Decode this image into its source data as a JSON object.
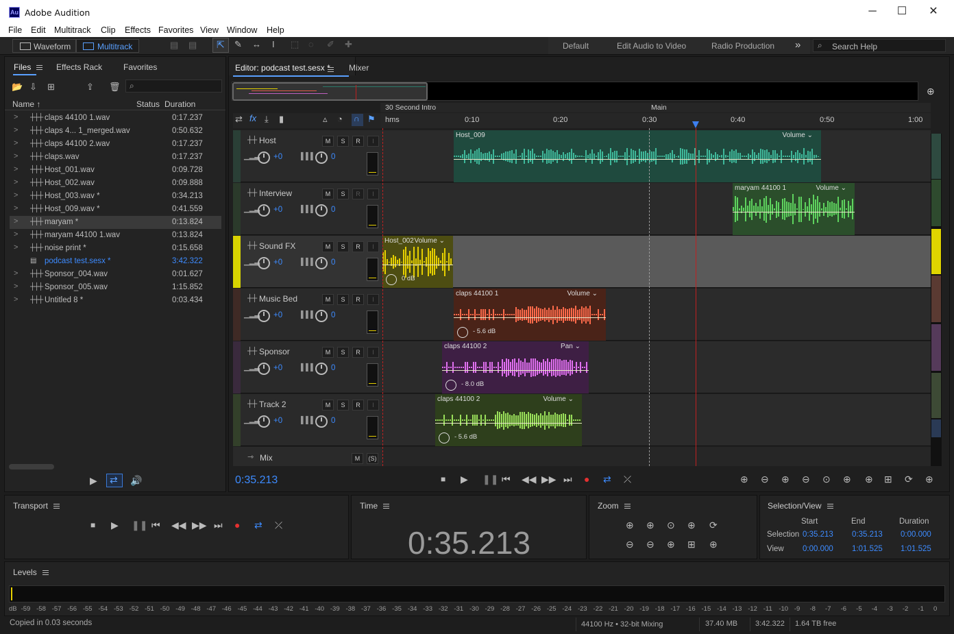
{
  "app": {
    "title": "Adobe Audition",
    "logo": "Au",
    "icons": {
      "minimize": "─",
      "maximize": "☐",
      "close": "✕"
    }
  },
  "menu": [
    "File",
    "Edit",
    "Multitrack",
    "Clip",
    "Effects",
    "Favorites",
    "View",
    "Window",
    "Help"
  ],
  "toolbar": {
    "waveform": "Waveform",
    "multitrack": "Multitrack",
    "workspaces": [
      "Default",
      "Edit Audio to Video",
      "Radio Production"
    ],
    "more": "»",
    "search_placeholder": "Search Help"
  },
  "files_panel": {
    "tabs": [
      "Files",
      "Effects Rack",
      "Favorites"
    ],
    "columns": {
      "name": "Name",
      "status": "Status",
      "duration": "Duration"
    },
    "items": [
      {
        "name": "claps 44100 1.wav",
        "duration": "0:17.237",
        "type": "wave"
      },
      {
        "name": "claps 4... 1_merged.wav",
        "duration": "0:50.632",
        "type": "wave"
      },
      {
        "name": "claps 44100 2.wav",
        "duration": "0:17.237",
        "type": "wave"
      },
      {
        "name": "claps.wav",
        "duration": "0:17.237",
        "type": "wave"
      },
      {
        "name": "Host_001.wav",
        "duration": "0:09.728",
        "type": "wave"
      },
      {
        "name": "Host_002.wav",
        "duration": "0:09.888",
        "type": "wave"
      },
      {
        "name": "Host_003.wav *",
        "duration": "0:34.213",
        "type": "wave"
      },
      {
        "name": "Host_009.wav *",
        "duration": "0:41.559",
        "type": "wave"
      },
      {
        "name": "maryam *",
        "duration": "0:13.824",
        "type": "wave",
        "selected": true
      },
      {
        "name": "maryam 44100 1.wav",
        "duration": "0:13.824",
        "type": "wave"
      },
      {
        "name": "noise print *",
        "duration": "0:15.658",
        "type": "wave"
      },
      {
        "name": "podcast test.sesx *",
        "duration": "3:42.322",
        "type": "session"
      },
      {
        "name": "Sponsor_004.wav",
        "duration": "0:01.627",
        "type": "wave"
      },
      {
        "name": "Sponsor_005.wav",
        "duration": "1:15.852",
        "type": "wave"
      },
      {
        "name": "Untitled 8 *",
        "duration": "0:03.434",
        "type": "wave"
      }
    ]
  },
  "editor": {
    "tab": "Editor: podcast test.sesx *",
    "mixer_tab": "Mixer",
    "time": "0:35.213",
    "markers": [
      "30 Second Intro",
      "Main"
    ],
    "ruler": [
      "hms",
      "0:10",
      "0:20",
      "0:30",
      "0:40",
      "0:50",
      "1:00"
    ],
    "tracks": [
      {
        "name": "Host",
        "vol": "+0",
        "pan": "0",
        "color": "#2c5b4c",
        "strip": "#2a3f36"
      },
      {
        "name": "Interview",
        "vol": "+0",
        "pan": "0",
        "color": "#2e5b2e",
        "strip": "#2b3a2b"
      },
      {
        "name": "Sound FX",
        "vol": "+0",
        "pan": "0",
        "color": "#6b6b20",
        "strip": "#d8d400"
      },
      {
        "name": "Music Bed",
        "vol": "+0",
        "pan": "0",
        "color": "#5a2d22",
        "strip": "#3f2a25"
      },
      {
        "name": "Sponsor",
        "vol": "+0",
        "pan": "0",
        "color": "#4f2a55",
        "strip": "#3a2a3d"
      },
      {
        "name": "Track 2",
        "vol": "+0",
        "pan": "0",
        "color": "#3d5225",
        "strip": "#33402a"
      }
    ],
    "mix_label": "Mix",
    "btn": {
      "m": "M",
      "s": "S",
      "r": "R",
      "i": "I"
    },
    "clips": [
      {
        "name": "Host_009",
        "env": "Volume"
      },
      {
        "name": "maryam 44100 1",
        "env": "Volume"
      },
      {
        "name": "Host_002",
        "env": "Volume",
        "db": "0 dB"
      },
      {
        "name": "claps 44100 1",
        "env": "Volume",
        "db": "- 5.6 dB"
      },
      {
        "name": "claps 44100 2",
        "env": "Pan",
        "db": "- 8.0 dB"
      },
      {
        "name": "claps 44100 2",
        "env": "Volume",
        "db": "- 5.6 dB"
      }
    ]
  },
  "transport": {
    "title": "Transport"
  },
  "time_panel": {
    "title": "Time",
    "value": "0:35.213"
  },
  "zoom_panel": {
    "title": "Zoom"
  },
  "selection_view": {
    "title": "Selection/View",
    "headers": [
      "Start",
      "End",
      "Duration"
    ],
    "selection": {
      "label": "Selection",
      "start": "0:35.213",
      "end": "0:35.213",
      "duration": "0:00.000"
    },
    "view": {
      "label": "View",
      "start": "0:00.000",
      "end": "1:01.525",
      "duration": "1:01.525"
    }
  },
  "levels": {
    "title": "Levels",
    "scale": [
      "dB",
      "-59",
      "-58",
      "-57",
      "-56",
      "-55",
      "-54",
      "-53",
      "-52",
      "-51",
      "-50",
      "-49",
      "-48",
      "-47",
      "-46",
      "-45",
      "-44",
      "-43",
      "-42",
      "-41",
      "-40",
      "-39",
      "-38",
      "-37",
      "-36",
      "-35",
      "-34",
      "-33",
      "-32",
      "-31",
      "-30",
      "-29",
      "-28",
      "-27",
      "-26",
      "-25",
      "-24",
      "-23",
      "-22",
      "-21",
      "-20",
      "-19",
      "-18",
      "-17",
      "-16",
      "-15",
      "-14",
      "-13",
      "-12",
      "-11",
      "-10",
      "-9",
      "-8",
      "-7",
      "-6",
      "-5",
      "-4",
      "-3",
      "-2",
      "-1",
      "0"
    ]
  },
  "status": {
    "message": "Copied in 0.03 seconds",
    "format": "44100 Hz • 32-bit Mixing",
    "memory": "37.40 MB",
    "duration": "3:42.322",
    "free": "1.64 TB free"
  }
}
